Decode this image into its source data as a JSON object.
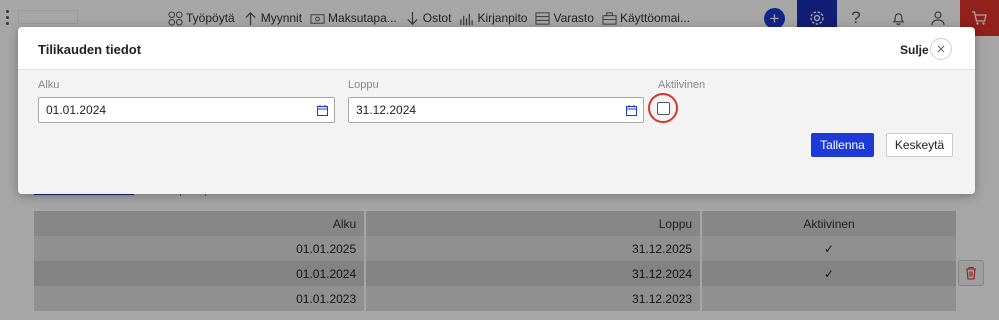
{
  "nav": {
    "items": [
      {
        "label": "Työpöytä",
        "icon": "dashboard-icon"
      },
      {
        "label": "Myynnit",
        "icon": "arrow-up-icon"
      },
      {
        "label": "Maksutapa...",
        "icon": "payment-icon"
      },
      {
        "label": "Ostot",
        "icon": "arrow-down-icon"
      },
      {
        "label": "Kirjanpito",
        "icon": "bar-chart-icon"
      },
      {
        "label": "Varasto",
        "icon": "warehouse-icon"
      },
      {
        "label": "Käyttöomai...",
        "icon": "briefcase-icon"
      }
    ],
    "add_symbol": "+",
    "help_symbol": "?"
  },
  "modal": {
    "title": "Tilikauden tiedot",
    "close_label": "Sulje",
    "start_label": "Alku",
    "start_value": "01.01.2024",
    "end_label": "Loppu",
    "end_value": "31.12.2024",
    "active_label": "Aktiivinen",
    "active_checked": false,
    "save_label": "Tallenna",
    "cancel_label": "Keskeytä"
  },
  "table": {
    "headers": [
      "Alku",
      "Loppu",
      "Aktiivinen"
    ],
    "rows": [
      {
        "start": "01.01.2025",
        "end": "31.12.2025",
        "active": "✓"
      },
      {
        "start": "01.01.2024",
        "end": "31.12.2024",
        "active": "✓"
      },
      {
        "start": "01.01.2023",
        "end": "31.12.2023",
        "active": ""
      }
    ]
  },
  "colors": {
    "accent": "#1e3ad6",
    "cart": "#e0322c",
    "highlight_ring": "#d9342b"
  }
}
